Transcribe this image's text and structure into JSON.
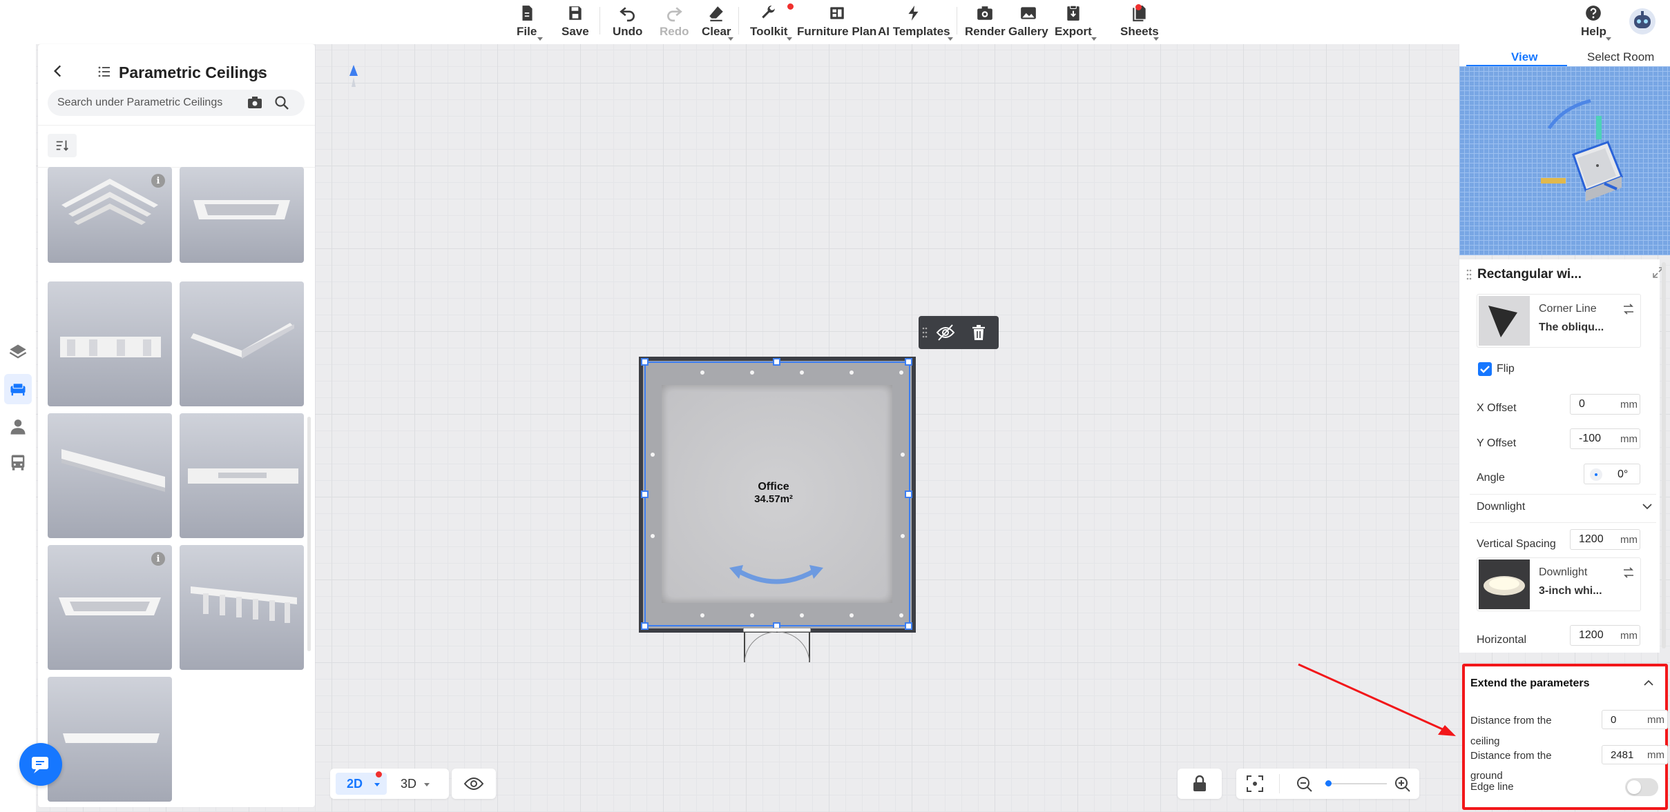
{
  "toolbar": {
    "file": "File",
    "save": "Save",
    "undo": "Undo",
    "redo": "Redo",
    "clear": "Clear",
    "toolkit": "Toolkit",
    "furniture_plan": "Furniture Plan",
    "ai_templates": "AI Templates",
    "render": "Render",
    "gallery": "Gallery",
    "export": "Export",
    "sheets": "Sheets",
    "help": "Help"
  },
  "catalog": {
    "title": "Parametric Ceilings",
    "search_placeholder": "Search under Parametric Ceilings",
    "info_glyph": "i",
    "thumbnails": [
      {
        "name": "corner-molding"
      },
      {
        "name": "rectangular-frame"
      },
      {
        "name": "panel-row"
      },
      {
        "name": "angle-molding"
      },
      {
        "name": "slanted-strip"
      },
      {
        "name": "recessed-strip"
      },
      {
        "name": "flat-frame"
      },
      {
        "name": "ribbed-strip"
      },
      {
        "name": "flat-panel"
      }
    ]
  },
  "canvas": {
    "room_name": "Office",
    "room_area": "34.57m²",
    "view_2d": "2D",
    "view_3d": "3D"
  },
  "right_panel": {
    "tab_view": "View",
    "tab_select_room": "Select Room",
    "title": "Rectangular wi...",
    "corner_line": {
      "category": "Corner Line",
      "name": "The obliqu..."
    },
    "flip_label": "Flip",
    "flip_checked": true,
    "x_offset": {
      "label": "X Offset",
      "value": "0",
      "unit": "mm"
    },
    "y_offset": {
      "label": "Y Offset",
      "value": "-100",
      "unit": "mm"
    },
    "angle": {
      "label": "Angle",
      "value": "0°"
    },
    "downlight_section": "Downlight",
    "vertical_spacing": {
      "label": "Vertical Spacing",
      "value": "1200",
      "unit": "mm"
    },
    "downlight": {
      "category": "Downlight",
      "name": "3-inch whi..."
    },
    "horizontal": {
      "label": "Horizontal",
      "value": "1200",
      "unit": "mm"
    }
  },
  "extend": {
    "title": "Extend the parameters",
    "ceiling_label_1": "Distance from the",
    "ceiling_label_2": "ceiling",
    "ceiling_value": "0",
    "ceiling_unit": "mm",
    "ground_label_1": "Distance from the",
    "ground_label_2": "ground",
    "ground_value": "2481",
    "ground_unit": "mm",
    "edge_line": "Edge line",
    "edge_line_on": false
  },
  "colors": {
    "accent": "#3d7ef0",
    "annotation_red": "#f2171a",
    "brand_blue": "#1677ff"
  }
}
